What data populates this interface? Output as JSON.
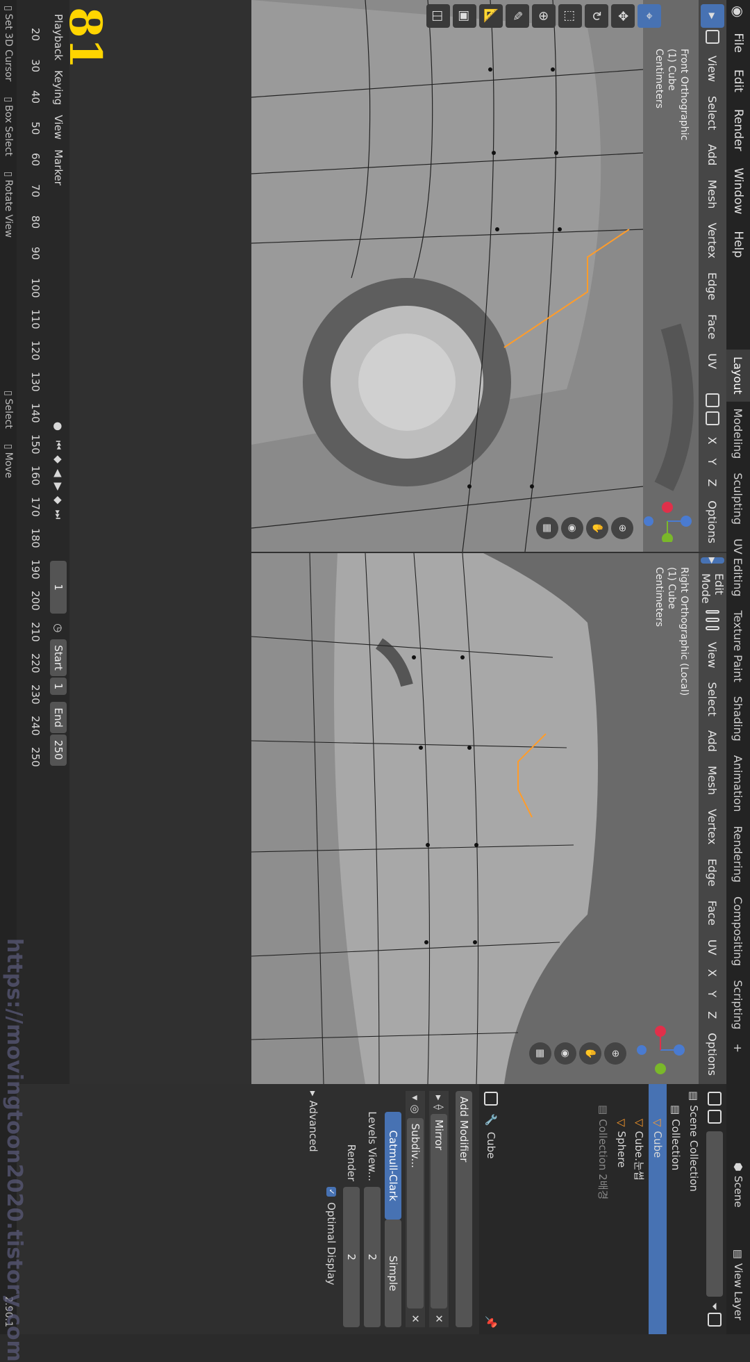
{
  "menu": [
    "File",
    "Edit",
    "Render",
    "Window",
    "Help"
  ],
  "workspaces": [
    "Layout",
    "Modeling",
    "Sculpting",
    "UV Editing",
    "Texture Paint",
    "Shading",
    "Animation",
    "Rendering",
    "Compositing",
    "Scripting"
  ],
  "workspace_add": "+",
  "scene": "Scene",
  "view_layer": "View Layer",
  "left_viewport": {
    "header": [
      "View",
      "Select",
      "Add",
      "Mesh",
      "Vertex",
      "Edge",
      "Face",
      "UV"
    ],
    "orientation": "Global",
    "axes": [
      "X",
      "Y",
      "Z"
    ],
    "options": "Options",
    "info": [
      "Front Orthographic",
      "(1) Cube",
      "Centimeters"
    ]
  },
  "right_viewport": {
    "mode": "Edit Mode",
    "header": [
      "View",
      "Select",
      "Add",
      "Mesh",
      "Vertex",
      "Edge",
      "Face",
      "UV"
    ],
    "orientation": "Global",
    "axes": [
      "X",
      "Y",
      "Z"
    ],
    "options": "Options",
    "info": [
      "Right Orthographic (Local)",
      "(1) Cube",
      "Centimeters"
    ]
  },
  "timeline": {
    "menu": [
      "Playback",
      "Keying",
      "View",
      "Marker"
    ],
    "current_frame": "81",
    "ticks": [
      "20",
      "30",
      "40",
      "50",
      "60",
      "70",
      "80",
      "90",
      "100",
      "110",
      "120",
      "130",
      "140",
      "150",
      "160",
      "170",
      "180",
      "190",
      "200",
      "210",
      "220",
      "230",
      "240",
      "250"
    ],
    "frame_field": "1",
    "start_label": "Start",
    "start": "1",
    "end_label": "End",
    "end": "250"
  },
  "status": {
    "items": [
      "Set 3D Cursor",
      "Box Select",
      "Rotate View",
      "Select",
      "Move"
    ],
    "version": "2.90.1"
  },
  "outliner": {
    "root": "Scene Collection",
    "collection": "Collection",
    "items": [
      "Cube",
      "Cube.눈썹",
      "Sphere"
    ],
    "collection2": "Collection 2배경"
  },
  "properties": {
    "object": "Cube",
    "add_modifier": "Add Modifier",
    "modifiers": [
      "Mirror",
      "Subdiv..."
    ],
    "subdiv_types": [
      "Catmull-Clark",
      "Simple"
    ],
    "levels_label": "Levels View...",
    "levels_view": "2",
    "render_label": "Render",
    "render": "2",
    "optimal_display": "Optimal Display",
    "advanced": "Advanced"
  },
  "watermark": "https://movingtoon2020.tistory.com",
  "colors": {
    "accent": "#4772b3",
    "selected": "#ff9c2a",
    "frame": "#ffd500"
  }
}
